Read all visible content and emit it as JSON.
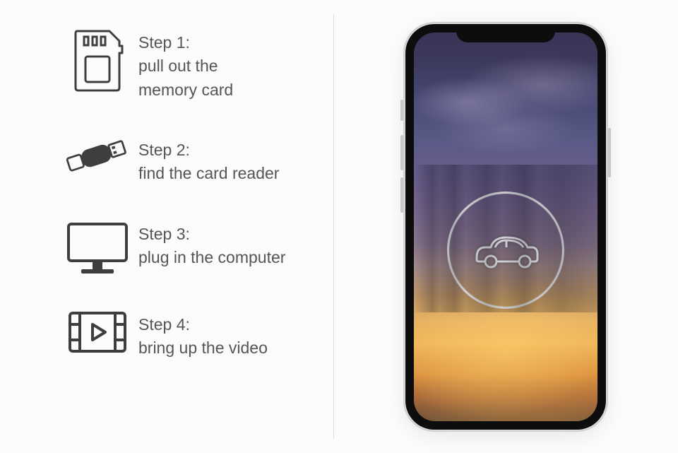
{
  "steps": [
    {
      "title": "Step 1:",
      "desc_a": "pull out the",
      "desc_b": " memory card"
    },
    {
      "title": "Step 2:",
      "desc_a": " find the card reader",
      "desc_b": ""
    },
    {
      "title": "Step 3:",
      "desc_a": "plug in the computer",
      "desc_b": ""
    },
    {
      "title": "Step 4:",
      "desc_a": "bring up the video",
      "desc_b": ""
    }
  ]
}
